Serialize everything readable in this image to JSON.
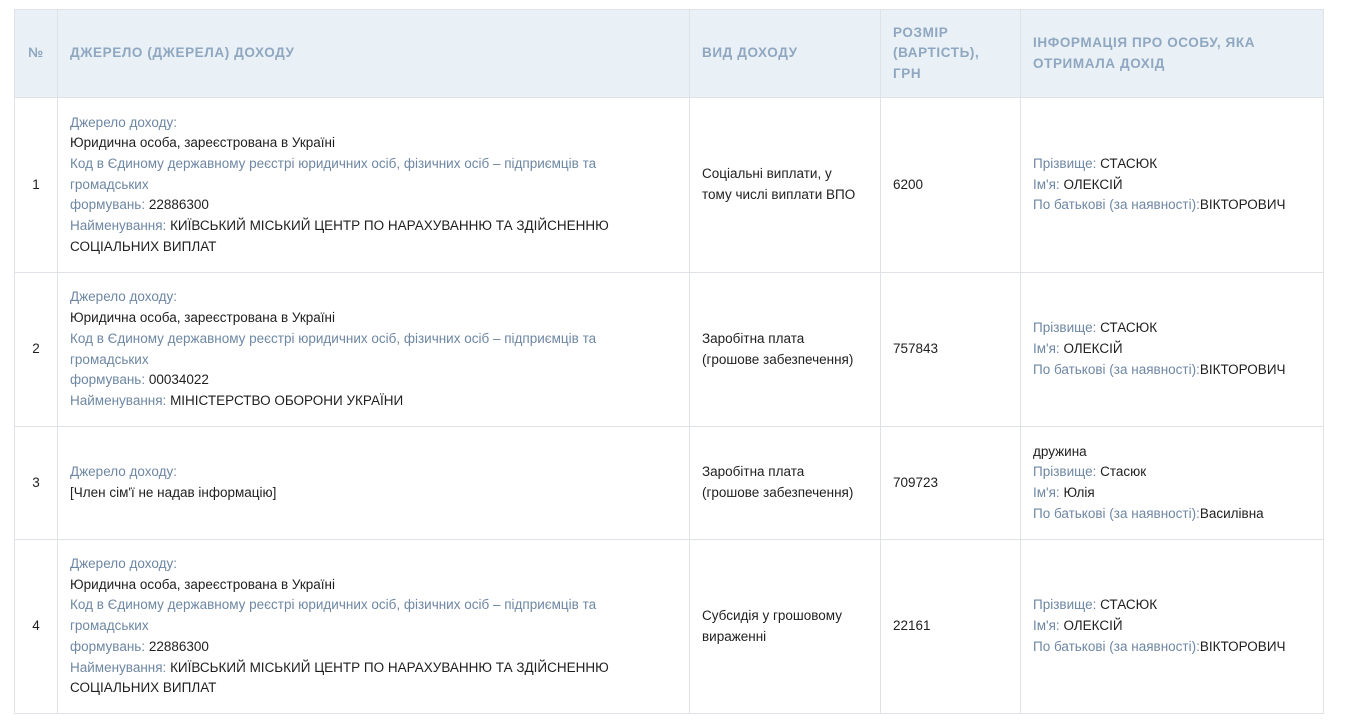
{
  "headers": {
    "num": "№",
    "source": "ДЖЕРЕЛО (ДЖЕРЕЛА) ДОХОДУ",
    "type": "ВИД ДОХОДУ",
    "amount_line1": "РОЗМІР",
    "amount_line2": "(ВАРТІСТЬ),",
    "amount_line3": "ГРН",
    "person_line1": "ІНФОРМАЦІЯ ПРО ОСОБУ, ЯКА",
    "person_line2": "ОТРИМАЛА ДОХІД"
  },
  "labels": {
    "source": "Джерело доходу:",
    "code_line1": "Код в Єдиному державному реєстрі юридичних осіб, фізичних осіб – підприємців та громадських",
    "code_line2": "формувань:",
    "name": "Найменування:",
    "surname": "Прізвище:",
    "first_name": "Ім'я:",
    "patronymic": "По батькові (за наявності):"
  },
  "rows": [
    {
      "num": "1",
      "source_type": "Юридична особа, зареєстрована в Україні",
      "code": "22886300",
      "name_line1": "КИЇВСЬКИЙ МІСЬКИЙ ЦЕНТР ПО НАРАХУВАННЮ ТА ЗДІЙСНЕННЮ",
      "name_line2": "СОЦІАЛЬНИХ ВИПЛАТ",
      "income_line1": "Соціальні виплати, у",
      "income_line2": "тому числі виплати ВПО",
      "amount": "6200",
      "surname": "СТАСЮК",
      "first_name": "ОЛЕКСІЙ",
      "patronymic": "ВІКТОРОВИЧ"
    },
    {
      "num": "2",
      "source_type": "Юридична особа, зареєстрована в Україні",
      "code": "00034022",
      "name_line1": "МІНІСТЕРСТВО ОБОРОНИ УКРАЇНИ",
      "income_line1": "Заробітна плата",
      "income_line2": "(грошове забезпечення)",
      "amount": "757843",
      "surname": "СТАСЮК",
      "first_name": "ОЛЕКСІЙ",
      "patronymic": "ВІКТОРОВИЧ"
    },
    {
      "num": "3",
      "source_note": "[Член сім'ї не надав інформацію]",
      "income_line1": "Заробітна плата",
      "income_line2": "(грошове забезпечення)",
      "amount": "709723",
      "relation": "дружина",
      "surname": "Стасюк",
      "first_name": "Юлія",
      "patronymic": "Василівна"
    },
    {
      "num": "4",
      "source_type": "Юридична особа, зареєстрована в Україні",
      "code": "22886300",
      "name_line1": "КИЇВСЬКИЙ МІСЬКИЙ ЦЕНТР ПО НАРАХУВАННЮ ТА ЗДІЙСНЕННЮ",
      "name_line2": "СОЦІАЛЬНИХ ВИПЛАТ",
      "income_line1": "Субсидія у грошовому",
      "income_line2": "вираженні",
      "amount": "22161",
      "surname": "СТАСЮК",
      "first_name": "ОЛЕКСІЙ",
      "patronymic": "ВІКТОРОВИЧ"
    }
  ]
}
